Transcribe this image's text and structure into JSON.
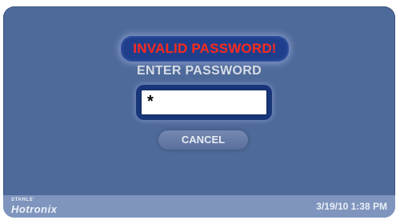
{
  "dialog": {
    "error_message": "INVALID PASSWORD!",
    "prompt": "ENTER PASSWORD",
    "password_value": "*",
    "cancel_label": "CANCEL"
  },
  "footer": {
    "brand_small": "STAHLS'",
    "brand_main": "Hotronix",
    "datetime": "3/19/10  1:38 PM"
  },
  "colors": {
    "panel": "#4e6a9a",
    "error_text": "#ff2a1e",
    "badge": "#1f3f8c",
    "footer": "#7f95bd"
  }
}
